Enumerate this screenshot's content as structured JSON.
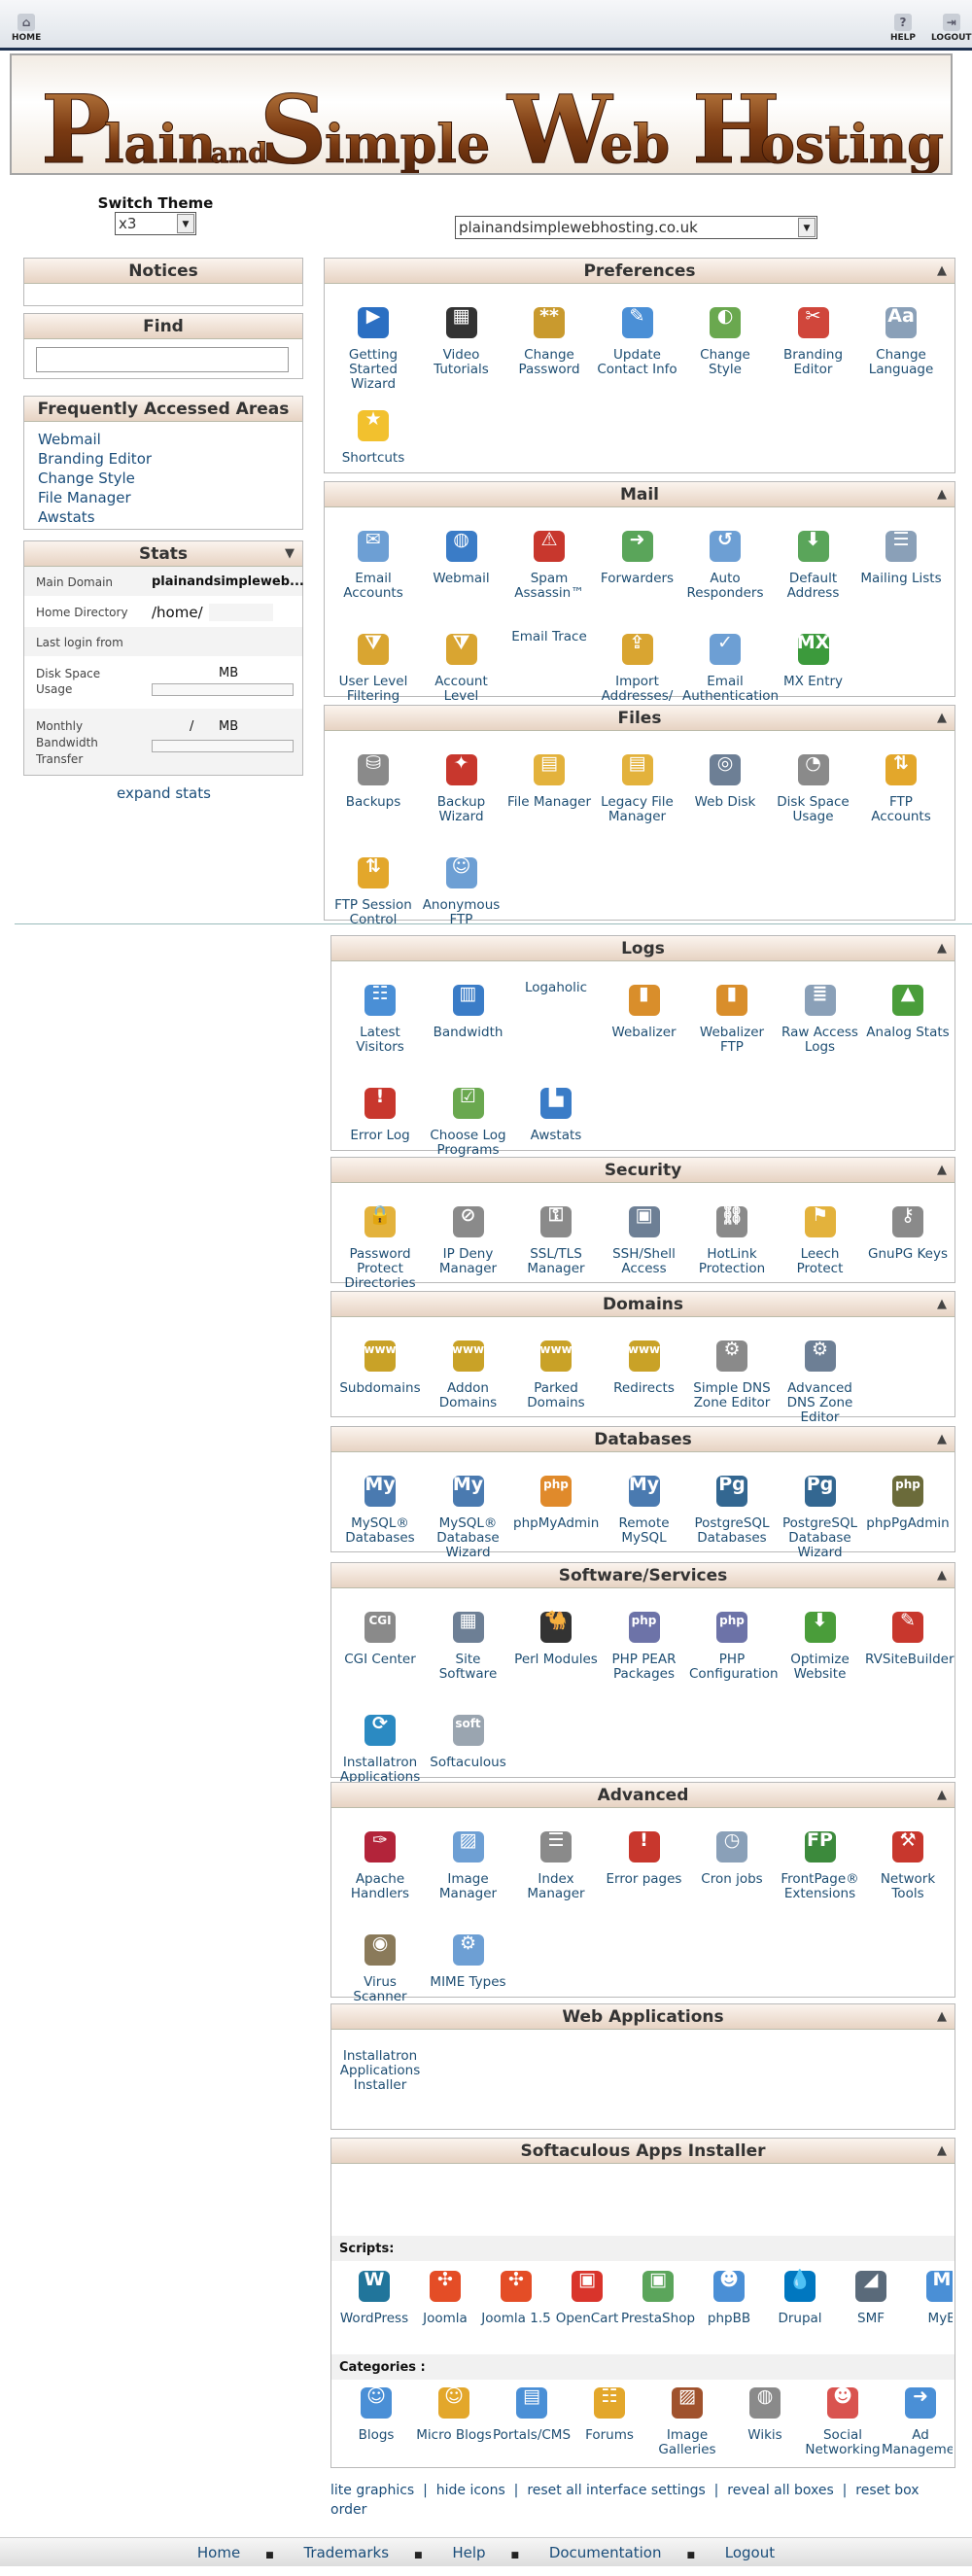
{
  "topnav": {
    "home": "HOME",
    "help": "HELP",
    "logout": "LOGOUT"
  },
  "banner": {
    "w1": "P",
    "w2": "lain",
    "w3": "and",
    "w4": "S",
    "w5": "imple",
    "w6": "W",
    "w7": "eb",
    "w8": "H",
    "w9": "osting"
  },
  "theme": {
    "label": "Switch Theme",
    "value": "x3"
  },
  "domain": {
    "value": "plainandsimplewebhosting.co.uk"
  },
  "notices": {
    "title": "Notices"
  },
  "find": {
    "title": "Find",
    "placeholder": ""
  },
  "faa": {
    "title": "Frequently Accessed Areas",
    "links": [
      "Webmail",
      "Branding Editor",
      "Change Style",
      "File Manager",
      "Awstats"
    ]
  },
  "stats": {
    "title": "Stats",
    "main_domain_label": "Main Domain",
    "main_domain": "plainandsimpleweb...",
    "home_label": "Home Directory",
    "home": "/home/",
    "last_login_label": "Last login from",
    "disk_label": "Disk Space Usage",
    "disk_unit": "MB",
    "bw_label": "Monthly Bandwidth Transfer",
    "bw_value": "/",
    "bw_unit": "MB",
    "expand": "expand stats"
  },
  "colors": {
    "accent": "#1a4d7a",
    "header_bg": "#e7d3c3",
    "banner_text": "#7a3a12"
  },
  "sections": [
    {
      "title": "Preferences",
      "items": [
        {
          "label": "Getting Started Wizard",
          "icon": "play-icon",
          "color": "#2b6fc2",
          "glyph": "▶"
        },
        {
          "label": "Video Tutorials",
          "icon": "clapperboard-icon",
          "color": "#333333",
          "glyph": "▦"
        },
        {
          "label": "Change Password",
          "icon": "lock-icon",
          "color": "#c99a2e",
          "glyph": "**"
        },
        {
          "label": "Update Contact Info",
          "icon": "contact-icon",
          "color": "#4a8fd6",
          "glyph": "✎"
        },
        {
          "label": "Change Style",
          "icon": "style-icon",
          "color": "#6aa84f",
          "glyph": "◐"
        },
        {
          "label": "Branding Editor",
          "icon": "branding-icon",
          "color": "#d0463b",
          "glyph": "✂"
        },
        {
          "label": "Change Language",
          "icon": "language-icon",
          "color": "#8aa0b8",
          "glyph": "Aa"
        },
        {
          "label": "Shortcuts",
          "icon": "star-icon",
          "color": "#f2c12e",
          "glyph": "★"
        }
      ]
    },
    {
      "title": "Mail",
      "items": [
        {
          "label": "Email Accounts",
          "icon": "envelope-icon",
          "color": "#6d9fd4",
          "glyph": "✉"
        },
        {
          "label": "Webmail",
          "icon": "globe-icon",
          "color": "#3a7cc7",
          "glyph": "◍"
        },
        {
          "label": "Spam Assassin™",
          "icon": "spam-icon",
          "color": "#c8372d",
          "glyph": "⚠"
        },
        {
          "label": "Forwarders",
          "icon": "forward-icon",
          "color": "#5aa55a",
          "glyph": "➜"
        },
        {
          "label": "Auto Responders",
          "icon": "autoresponder-icon",
          "color": "#6d9fd4",
          "glyph": "↺"
        },
        {
          "label": "Default Address",
          "icon": "default-address-icon",
          "color": "#5aa55a",
          "glyph": "⬇"
        },
        {
          "label": "Mailing Lists",
          "icon": "mailing-list-icon",
          "color": "#8aa0b8",
          "glyph": "☰"
        },
        {
          "label": "User Level Filtering",
          "icon": "filter-icon",
          "color": "#d9a531",
          "glyph": "⧩"
        },
        {
          "label": "Account Level Filtering",
          "icon": "filter-account-icon",
          "color": "#d9a531",
          "glyph": "⧩"
        },
        {
          "label": "Email Trace",
          "icon": "",
          "color": "",
          "glyph": ""
        },
        {
          "label": "Import Addresses/ Forwarders",
          "icon": "import-icon",
          "color": "#d9a531",
          "glyph": "⇪"
        },
        {
          "label": "Email Authentication",
          "icon": "auth-icon",
          "color": "#6d9fd4",
          "glyph": "✓"
        },
        {
          "label": "MX Entry",
          "icon": "mx-icon",
          "color": "#3c9a3c",
          "glyph": "MX"
        }
      ]
    },
    {
      "title": "Files",
      "items": [
        {
          "label": "Backups",
          "icon": "backup-icon",
          "color": "#8a8a8a",
          "glyph": "⛁"
        },
        {
          "label": "Backup Wizard",
          "icon": "backup-wizard-icon",
          "color": "#c8372d",
          "glyph": "✦"
        },
        {
          "label": "File Manager",
          "icon": "folder-icon",
          "color": "#e3b23c",
          "glyph": "▤"
        },
        {
          "label": "Legacy File Manager",
          "icon": "legacy-folder-icon",
          "color": "#e3b23c",
          "glyph": "▤"
        },
        {
          "label": "Web Disk",
          "icon": "web-disk-icon",
          "color": "#6d7f95",
          "glyph": "◎"
        },
        {
          "label": "Disk Space Usage",
          "icon": "disk-usage-icon",
          "color": "#8a8a8a",
          "glyph": "◔"
        },
        {
          "label": "FTP Accounts",
          "icon": "ftp-icon",
          "color": "#e3a72b",
          "glyph": "⇅"
        },
        {
          "label": "FTP Session Control",
          "icon": "ftp-session-icon",
          "color": "#e3a72b",
          "glyph": "⇅"
        },
        {
          "label": "Anonymous FTP",
          "icon": "anonymous-ftp-icon",
          "color": "#6d9fd4",
          "glyph": "☺"
        }
      ]
    },
    {
      "title": "Logs",
      "items": [
        {
          "label": "Latest Visitors",
          "icon": "visitors-icon",
          "color": "#4a8fd6",
          "glyph": "☷"
        },
        {
          "label": "Bandwidth",
          "icon": "bandwidth-icon",
          "color": "#3a7cc7",
          "glyph": "▥"
        },
        {
          "label": "Logaholic",
          "icon": "",
          "color": "",
          "glyph": ""
        },
        {
          "label": "Webalizer",
          "icon": "webalizer-icon",
          "color": "#d98e2b",
          "glyph": "▮"
        },
        {
          "label": "Webalizer FTP",
          "icon": "webalizer-ftp-icon",
          "color": "#d98e2b",
          "glyph": "▮"
        },
        {
          "label": "Raw Access Logs",
          "icon": "raw-logs-icon",
          "color": "#8aa0b8",
          "glyph": "≣"
        },
        {
          "label": "Analog Stats",
          "icon": "analog-stats-icon",
          "color": "#4a9d3a",
          "glyph": "▲"
        },
        {
          "label": "Error Log",
          "icon": "error-log-icon",
          "color": "#c8372d",
          "glyph": "!"
        },
        {
          "label": "Choose Log Programs",
          "icon": "log-programs-icon",
          "color": "#6aa84f",
          "glyph": "☑"
        },
        {
          "label": "Awstats",
          "icon": "awstats-icon",
          "color": "#3a7cc7",
          "glyph": "▙"
        }
      ]
    },
    {
      "title": "Security",
      "items": [
        {
          "label": "Password Protect Directories",
          "icon": "folder-lock-icon",
          "color": "#e3b23c",
          "glyph": "🔒"
        },
        {
          "label": "IP Deny Manager",
          "icon": "ip-deny-icon",
          "color": "#8a8a8a",
          "glyph": "⊘"
        },
        {
          "label": "SSL/TLS Manager",
          "icon": "ssl-icon",
          "color": "#8a8a8a",
          "glyph": "⚿"
        },
        {
          "label": "SSH/Shell Access",
          "icon": "ssh-icon",
          "color": "#6d7f95",
          "glyph": "▣"
        },
        {
          "label": "HotLink Protection",
          "icon": "hotlink-icon",
          "color": "#8a8a8a",
          "glyph": "⛓"
        },
        {
          "label": "Leech Protect",
          "icon": "leech-icon",
          "color": "#e3b23c",
          "glyph": "⚑"
        },
        {
          "label": "GnuPG Keys",
          "icon": "key-icon",
          "color": "#8a8a8a",
          "glyph": "⚷"
        }
      ]
    },
    {
      "title": "Domains",
      "items": [
        {
          "label": "Subdomains",
          "icon": "subdomain-icon",
          "color": "#c9a227",
          "glyph": "www"
        },
        {
          "label": "Addon Domains",
          "icon": "addon-domain-icon",
          "color": "#c9a227",
          "glyph": "www"
        },
        {
          "label": "Parked Domains",
          "icon": "parked-domain-icon",
          "color": "#c9a227",
          "glyph": "www"
        },
        {
          "label": "Redirects",
          "icon": "redirect-icon",
          "color": "#c9a227",
          "glyph": "www"
        },
        {
          "label": "Simple DNS Zone Editor",
          "icon": "dns-simple-icon",
          "color": "#8a8a8a",
          "glyph": "⚙"
        },
        {
          "label": "Advanced DNS Zone Editor",
          "icon": "dns-advanced-icon",
          "color": "#6d7f95",
          "glyph": "⚙"
        }
      ]
    },
    {
      "title": "Databases",
      "items": [
        {
          "label": "MySQL® Databases",
          "icon": "mysql-icon",
          "color": "#4a7ab0",
          "glyph": "My"
        },
        {
          "label": "MySQL® Database Wizard",
          "icon": "mysql-wizard-icon",
          "color": "#4a7ab0",
          "glyph": "My"
        },
        {
          "label": "phpMyAdmin",
          "icon": "phpmyadmin-icon",
          "color": "#e08a2b",
          "glyph": "php"
        },
        {
          "label": "Remote MySQL",
          "icon": "remote-mysql-icon",
          "color": "#4a7ab0",
          "glyph": "My"
        },
        {
          "label": "PostgreSQL Databases",
          "icon": "postgres-icon",
          "color": "#336791",
          "glyph": "Pg"
        },
        {
          "label": "PostgreSQL Database Wizard",
          "icon": "postgres-wizard-icon",
          "color": "#336791",
          "glyph": "Pg"
        },
        {
          "label": "phpPgAdmin",
          "icon": "phppgadmin-icon",
          "color": "#6b6b3a",
          "glyph": "php"
        }
      ]
    },
    {
      "title": "Software/Services",
      "items": [
        {
          "label": "CGI Center",
          "icon": "cgi-icon",
          "color": "#8a8a8a",
          "glyph": "CGI"
        },
        {
          "label": "Site Software",
          "icon": "site-software-icon",
          "color": "#6d7f95",
          "glyph": "▦"
        },
        {
          "label": "Perl Modules",
          "icon": "perl-icon",
          "color": "#333333",
          "glyph": "🐪"
        },
        {
          "label": "PHP PEAR Packages",
          "icon": "php-pear-icon",
          "color": "#6d73a8",
          "glyph": "php"
        },
        {
          "label": "PHP Configuration",
          "icon": "php-config-icon",
          "color": "#6d73a8",
          "glyph": "php"
        },
        {
          "label": "Optimize Website",
          "icon": "optimize-icon",
          "color": "#4a9d3a",
          "glyph": "⬇"
        },
        {
          "label": "RVSiteBuilder",
          "icon": "rvsitebuilder-icon",
          "color": "#c8372d",
          "glyph": "✎"
        },
        {
          "label": "Installatron Applications Installer",
          "icon": "installatron-icon",
          "color": "#2b8ac2",
          "glyph": "⟳"
        },
        {
          "label": "Softaculous",
          "icon": "softaculous-icon",
          "color": "#9aa5b0",
          "glyph": "soft"
        }
      ]
    },
    {
      "title": "Advanced",
      "items": [
        {
          "label": "Apache Handlers",
          "icon": "apache-icon",
          "color": "#b3243a",
          "glyph": "✑"
        },
        {
          "label": "Image Manager",
          "icon": "image-manager-icon",
          "color": "#6d9fd4",
          "glyph": "▨"
        },
        {
          "label": "Index Manager",
          "icon": "index-manager-icon",
          "color": "#8a8a8a",
          "glyph": "☰"
        },
        {
          "label": "Error pages",
          "icon": "error-pages-icon",
          "color": "#c8372d",
          "glyph": "!"
        },
        {
          "label": "Cron jobs",
          "icon": "cron-icon",
          "color": "#8aa0b8",
          "glyph": "◷"
        },
        {
          "label": "FrontPage® Extensions",
          "icon": "frontpage-icon",
          "color": "#3c8a3c",
          "glyph": "FP"
        },
        {
          "label": "Network Tools",
          "icon": "network-tools-icon",
          "color": "#c8372d",
          "glyph": "⚒"
        },
        {
          "label": "Virus Scanner",
          "icon": "virus-scanner-icon",
          "color": "#8a7a5a",
          "glyph": "◉"
        },
        {
          "label": "MIME Types",
          "icon": "mime-icon",
          "color": "#6d9fd4",
          "glyph": "⚙"
        }
      ]
    },
    {
      "title": "Web Applications",
      "items": [
        {
          "label": "Installatron Applications Installer",
          "icon": "",
          "color": "",
          "glyph": ""
        }
      ]
    },
    {
      "title": "Softaculous Apps Installer",
      "scripts_label": "Scripts:",
      "categories_label": "Categories :",
      "scripts": [
        {
          "label": "WordPress",
          "icon": "wordpress-icon",
          "color": "#21759b",
          "glyph": "W"
        },
        {
          "label": "Joomla",
          "icon": "joomla-icon",
          "color": "#e44d26",
          "glyph": "✣"
        },
        {
          "label": "Joomla 1.5",
          "icon": "joomla15-icon",
          "color": "#e44d26",
          "glyph": "✣"
        },
        {
          "label": "OpenCart",
          "icon": "opencart-icon",
          "color": "#d9342b",
          "glyph": "▣"
        },
        {
          "label": "PrestaShop",
          "icon": "prestashop-icon",
          "color": "#5ba55b",
          "glyph": "▣"
        },
        {
          "label": "phpBB",
          "icon": "phpbb-icon",
          "color": "#4a8fd6",
          "glyph": "☻"
        },
        {
          "label": "Drupal",
          "icon": "drupal-icon",
          "color": "#0077c0",
          "glyph": "💧"
        },
        {
          "label": "SMF",
          "icon": "smf-icon",
          "color": "#5a6a7a",
          "glyph": "◢"
        },
        {
          "label": "MyB",
          "icon": "mybb-icon",
          "color": "#4a8fd6",
          "glyph": "M"
        }
      ],
      "categories": [
        {
          "label": "Blogs",
          "icon": "blogs-icon",
          "color": "#4a8fd6",
          "glyph": "☺"
        },
        {
          "label": "Micro Blogs",
          "icon": "micro-blogs-icon",
          "color": "#e3a72b",
          "glyph": "☺"
        },
        {
          "label": "Portals/CMS",
          "icon": "portals-icon",
          "color": "#4a8fd6",
          "glyph": "▤"
        },
        {
          "label": "Forums",
          "icon": "forums-icon",
          "color": "#e3a72b",
          "glyph": "☷"
        },
        {
          "label": "Image Galleries",
          "icon": "galleries-icon",
          "color": "#a0522d",
          "glyph": "▨"
        },
        {
          "label": "Wikis",
          "icon": "wikis-icon",
          "color": "#8a8a8a",
          "glyph": "◍"
        },
        {
          "label": "Social Networking",
          "icon": "social-icon",
          "color": "#d9534f",
          "glyph": "☻"
        },
        {
          "label": "Ad Management",
          "icon": "ad-icon",
          "color": "#4a8fd6",
          "glyph": "➜"
        }
      ]
    }
  ],
  "bottom_links": [
    "lite graphics",
    "hide icons",
    "reset all interface settings",
    "reveal all boxes",
    "reset box order"
  ],
  "footer": [
    "Home",
    "Trademarks",
    "Help",
    "Documentation",
    "Logout"
  ]
}
